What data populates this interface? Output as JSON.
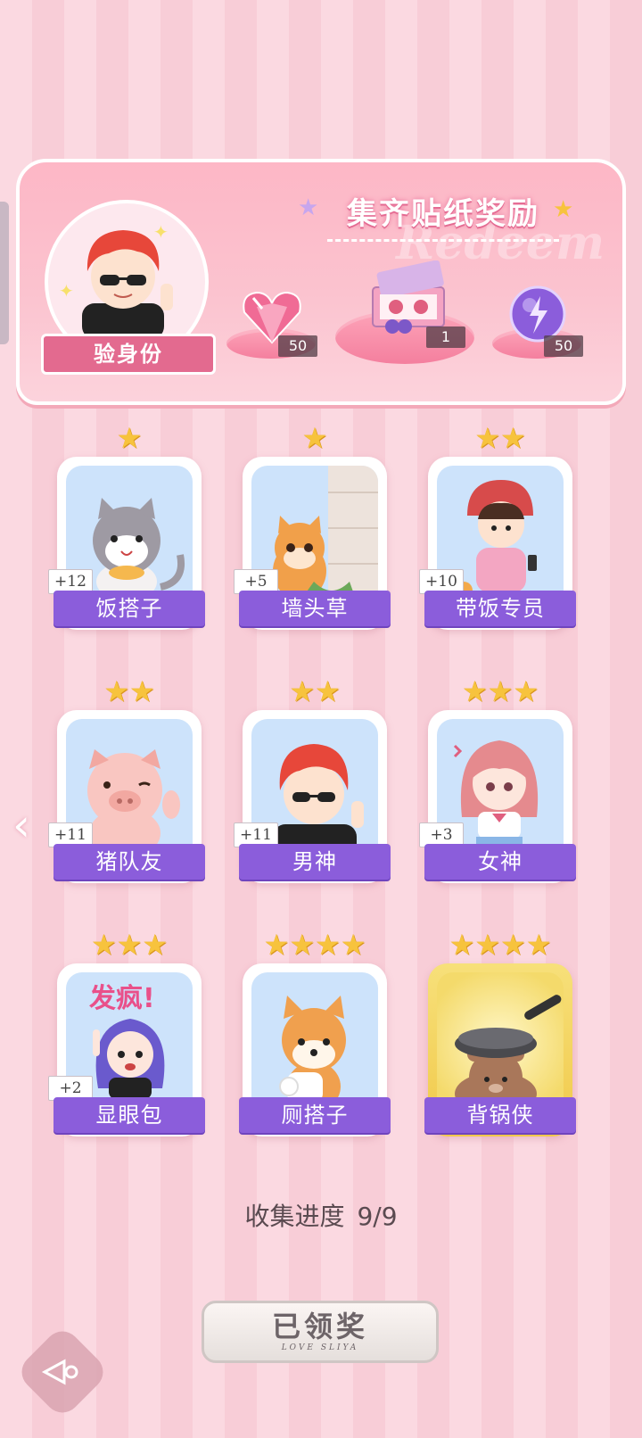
{
  "banner": {
    "title": "集齐贴纸奖励",
    "watermark": "Redeem",
    "identity_label": "验身份",
    "rewards": [
      {
        "name": "pink-heart-gem-icon",
        "quantity": "50"
      },
      {
        "name": "gift-box-icon",
        "quantity": "1"
      },
      {
        "name": "purple-energy-orb-icon",
        "quantity": "50"
      }
    ]
  },
  "stickers": [
    {
      "name": "饭搭子",
      "stars": "★",
      "count": "+12"
    },
    {
      "name": "墙头草",
      "stars": "★",
      "count": "+5"
    },
    {
      "name": "带饭专员",
      "stars": "★★",
      "count": "+10"
    },
    {
      "name": "猪队友",
      "stars": "★★",
      "count": "+11"
    },
    {
      "name": "男神",
      "stars": "★★",
      "count": "+11"
    },
    {
      "name": "女神",
      "stars": "★★★",
      "count": "+3"
    },
    {
      "name": "显眼包",
      "stars": "★★★",
      "count": "+2",
      "art_text": "发疯!"
    },
    {
      "name": "厕搭子",
      "stars": "★★★★",
      "count": ""
    },
    {
      "name": "背锅侠",
      "stars": "★★★★",
      "count": ""
    }
  ],
  "progress": {
    "label": "收集进度",
    "value": "9/9"
  },
  "claim_button": {
    "label": "已领奖",
    "sub": "LOVE SLIYA"
  },
  "colors": {
    "accent": "#8b5ddb",
    "banner": "#fdb7c6",
    "gold": "#f7c33d"
  }
}
